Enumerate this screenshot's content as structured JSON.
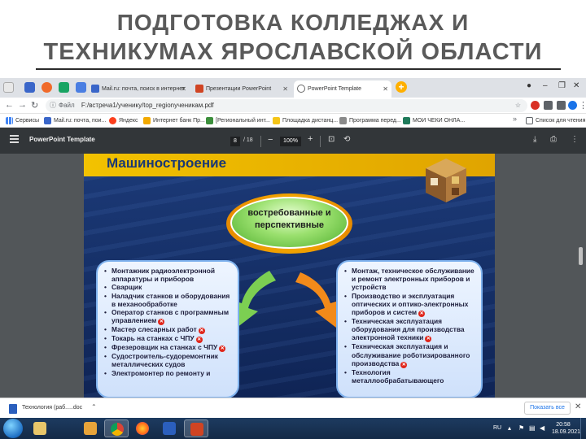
{
  "slide": {
    "title_line1": "ПОДГОТОВКА  КОЛЛЕДЖАХ И",
    "title_line2": "ТЕХНИКУМАХ ЯРОСЛАВСКОЙ ОБЛАСТИ"
  },
  "browser": {
    "tabs": [
      {
        "label": "Mail.ru: почта, поиск в интернет",
        "icon": "mail-icon",
        "active": false
      },
      {
        "label": "Презентации PowerPoint",
        "icon": "powerpoint-icon",
        "active": false
      },
      {
        "label": "PowerPoint Template",
        "icon": "globe-icon",
        "active": true
      }
    ],
    "address": {
      "scheme_label": "Файл",
      "url": "F:/встреча1/ученику/top_regionученикам.pdf"
    },
    "bookmarks": [
      {
        "label": "Сервисы",
        "icon": "apps-icon"
      },
      {
        "label": "Mail.ru: почта, пои...",
        "icon": "mail-icon"
      },
      {
        "label": "Яндекс",
        "icon": "yandex-icon"
      },
      {
        "label": "Интернет банк Пр...",
        "icon": "bank-icon"
      },
      {
        "label": "[Региональный инт...",
        "icon": "region-icon"
      },
      {
        "label": "Площадка дистанц...",
        "icon": "folder-icon"
      },
      {
        "label": "Программа перед...",
        "icon": "program-icon"
      },
      {
        "label": "МОИ ЧЕКИ ОНЛА...",
        "icon": "receipt-icon"
      },
      {
        "label": "Список для чтения",
        "icon": "reading-list-icon"
      }
    ],
    "colors": {
      "tab_strip": "#dee1e6",
      "accent": "#1a73e8"
    }
  },
  "pdf_viewer": {
    "title": "PowerPoint Template",
    "page_current": "8",
    "page_total": "/ 18",
    "zoom": "100%"
  },
  "pdf_page": {
    "header": "Машиностроение",
    "center_label_line1": "востребованные и",
    "center_label_line2": "перспективные",
    "left_list": [
      {
        "text": "Монтажник радиоэлектронной аппаратуры и приборов",
        "mark": false
      },
      {
        "text": "Сварщик",
        "mark": false
      },
      {
        "text": "Наладчик станков и оборудования в механообработке",
        "mark": false
      },
      {
        "text": "Оператор станков с программным управлением",
        "mark": true
      },
      {
        "text": "Мастер слесарных работ",
        "mark": true
      },
      {
        "text": "Токарь на станках с ЧПУ",
        "mark": true
      },
      {
        "text": "Фрезеровщик на станках с ЧПУ",
        "mark": true
      },
      {
        "text": "Судостроитель-судоремонтник металлических судов",
        "mark": false
      },
      {
        "text": "Электромонтер по ремонту и",
        "mark": false
      }
    ],
    "right_list": [
      {
        "text": "Монтаж, техническое обслуживание и ремонт электронных приборов и устройств",
        "mark": false
      },
      {
        "text": "Производство и эксплуатация оптических и оптико-электронных приборов и систем",
        "mark": true
      },
      {
        "text": "Техническая эксплуатация оборудования для производства электронной техники",
        "mark": true
      },
      {
        "text": "Техническая эксплуатация и обслуживание роботизированного производства",
        "mark": true
      },
      {
        "text": "Технология металлообрабатывающего",
        "mark": false
      }
    ],
    "colors": {
      "band": "#f2c200",
      "oval": "#8fd66a",
      "arrow_left": "#7ccf52",
      "arrow_right": "#f28a1a"
    }
  },
  "download_bar": {
    "file_label": "Технология (раб.....doc",
    "show_all": "Показать все"
  },
  "taskbar": {
    "apps": [
      "explorer-icon",
      "media-player-icon",
      "chrome-icon",
      "firefox-icon",
      "word-icon",
      "powerpoint-icon"
    ],
    "language": "RU",
    "time": "20:58",
    "date": "18.09.2021"
  }
}
